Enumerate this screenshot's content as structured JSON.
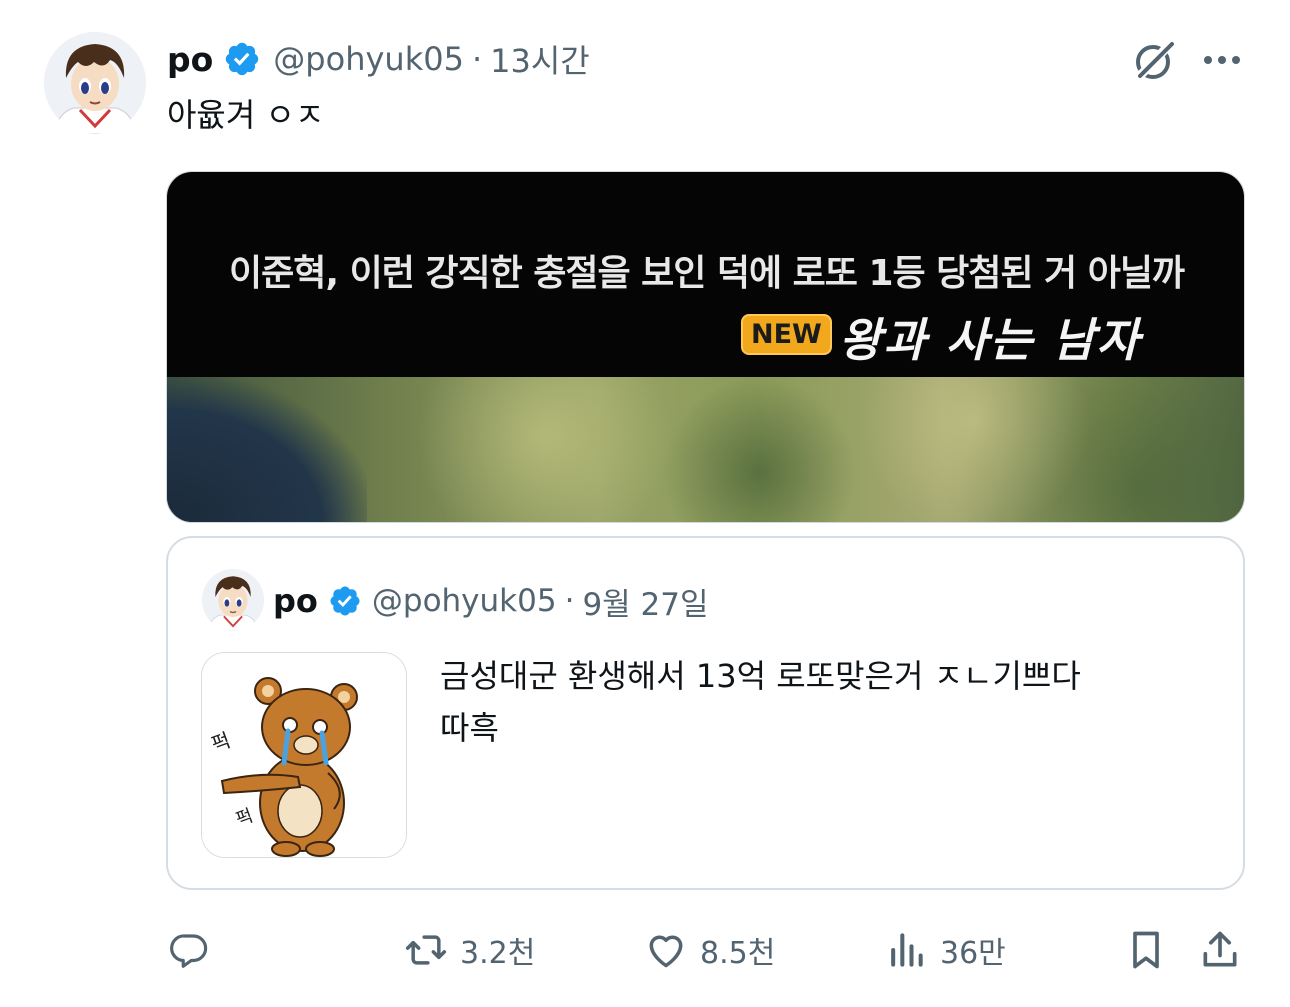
{
  "tweet": {
    "author": {
      "name": "po",
      "handle": "@pohyuk05",
      "verified_icon": "verified-badge-icon"
    },
    "separator": "·",
    "time": "13시간",
    "text": "아윲겨  ㅇㅈ",
    "media": {
      "caption": "이준혁, 이런 강직한 충절을 보인 덕에 로또 1등 당첨된 거 아닐까",
      "badge": "NEW",
      "show_title": "왕과 사는 남자"
    },
    "quoted": {
      "author": {
        "name": "po",
        "handle": "@pohyuk05"
      },
      "separator": "·",
      "time": "9월 27일",
      "text_line1": "금성대군 환생해서   13억 로또맞은거 ㅈㄴ기쁘다",
      "text_line2": "따흑",
      "thumb_text_top": "퍽",
      "thumb_text_bottom": "퍽"
    },
    "actions": {
      "reply": {
        "icon": "reply-icon",
        "count": ""
      },
      "retweet": {
        "icon": "retweet-icon",
        "count": "3.2천"
      },
      "like": {
        "icon": "heart-icon",
        "count": "8.5천"
      },
      "views": {
        "icon": "views-icon",
        "count": "36만"
      },
      "bookmark": {
        "icon": "bookmark-icon"
      },
      "share": {
        "icon": "share-icon"
      }
    }
  },
  "colors": {
    "text": "#0f1419",
    "secondary": "#536471",
    "verified": "#1d9bf0",
    "border": "#cfd9de"
  }
}
